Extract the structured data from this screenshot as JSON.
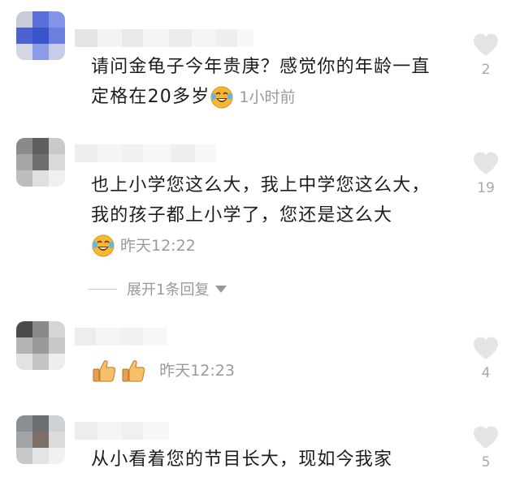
{
  "comments": [
    {
      "id": "c1",
      "text": "请问金龟子今年贵庚？感觉你的年龄一直定格在20多岁",
      "time": "1小时前",
      "likes": "2",
      "emoji": "laughing-tears"
    },
    {
      "id": "c2",
      "text": "也上小学您这么大，我上中学您这么大，我的孩子都上小学了，您还是这么大",
      "time": "昨天12:22",
      "likes": "19",
      "emoji": "laughing-tears"
    },
    {
      "id": "c3",
      "text": "",
      "time": "昨天12:23",
      "likes": "4",
      "emoji": "thumbs-up-x2"
    },
    {
      "id": "c4",
      "text": "从小看着您的节目长大，现如今我家",
      "time": "",
      "likes": "5"
    }
  ],
  "expand_replies": "展开1条回复",
  "colors": {
    "meta_gray": "#9a9a9a",
    "heart_gray": "#e4e4e4",
    "emoji_yellow": "#f7b733"
  }
}
